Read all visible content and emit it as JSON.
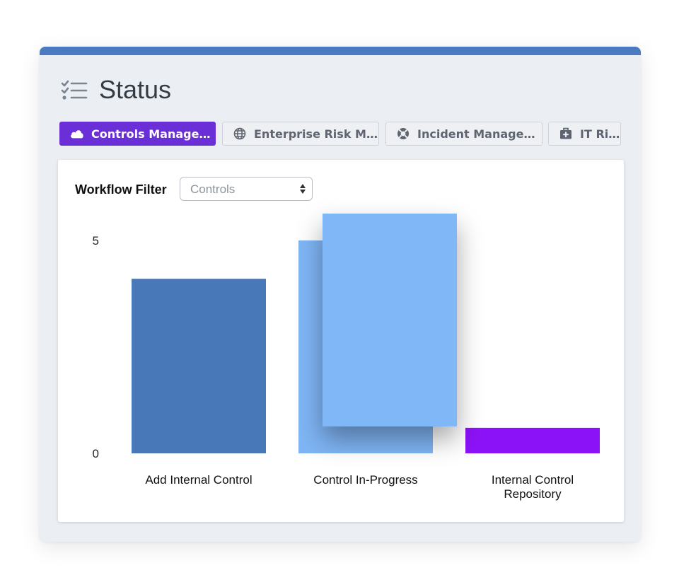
{
  "header": {
    "title": "Status",
    "icon": "checklist-icon"
  },
  "tabs": [
    {
      "label": "Controls Managem…",
      "icon": "cloud-icon",
      "active": true
    },
    {
      "label": "Enterprise Risk Ma…",
      "icon": "globe-icon",
      "active": false
    },
    {
      "label": "Incident Managem…",
      "icon": "lifebuoy-icon",
      "active": false
    },
    {
      "label": "IT Risk",
      "icon": "medkit-icon",
      "active": false
    }
  ],
  "filter": {
    "label": "Workflow Filter",
    "value": "Controls"
  },
  "colors": {
    "accent_bar": "#4a7bc0",
    "active_tab": "#6a2fd6",
    "bar_blue": "#4878b8",
    "bar_light_blue": "#7fb5f5",
    "bar_purple": "#8b12f6"
  },
  "chart_data": {
    "type": "bar",
    "categories": [
      [
        "Add Internal Control"
      ],
      [
        "Control In-Progress"
      ],
      [
        "Internal Control",
        "Repository"
      ]
    ],
    "values": [
      4.1,
      5.0,
      0.6
    ],
    "highlight_value": 5.0,
    "yticks": [
      0,
      5
    ],
    "ylim": [
      0,
      5.5
    ],
    "grid": false,
    "legend": "none"
  }
}
